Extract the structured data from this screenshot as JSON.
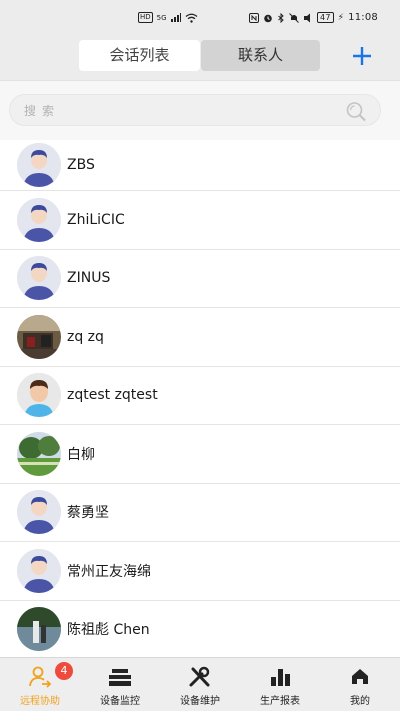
{
  "status_bar": {
    "hd_label": "HD",
    "network_label": "5G",
    "battery": "47",
    "time": "11:08"
  },
  "header": {
    "tabs": [
      {
        "label": "会话列表",
        "active": true
      },
      {
        "label": "联系人",
        "active": false
      }
    ],
    "add_icon": "plus-icon"
  },
  "search": {
    "placeholder": "搜索",
    "icon": "search-icon"
  },
  "contacts": [
    {
      "name": "ZBS",
      "avatar": "default-avatar"
    },
    {
      "name": "ZhiLiCIC",
      "avatar": "default-avatar"
    },
    {
      "name": "ZINUS",
      "avatar": "default-avatar"
    },
    {
      "name": "zq zq",
      "avatar": "photo-avatar"
    },
    {
      "name": "zqtest zqtest",
      "avatar": "cartoon-avatar"
    },
    {
      "name": "白柳",
      "avatar": "photo-avatar"
    },
    {
      "name": "蔡勇坚",
      "avatar": "default-avatar"
    },
    {
      "name": "常州正友海绵",
      "avatar": "default-avatar"
    },
    {
      "name": "陈祖彪 Chen",
      "avatar": "photo-avatar"
    }
  ],
  "tab_bar": {
    "items": [
      {
        "label": "远程协助",
        "icon": "person-help-icon",
        "active": true,
        "badge": "4"
      },
      {
        "label": "设备监控",
        "icon": "device-stack-icon",
        "active": false
      },
      {
        "label": "设备维护",
        "icon": "tools-icon",
        "active": false
      },
      {
        "label": "生产报表",
        "icon": "bar-chart-icon",
        "active": false
      },
      {
        "label": "我的",
        "icon": "home-icon",
        "active": false
      }
    ]
  },
  "colors": {
    "accent": "#1a73e8",
    "active_tab": "#f0a21c",
    "badge": "#ee4b3c",
    "avatar_blue": "#4a55a8"
  }
}
